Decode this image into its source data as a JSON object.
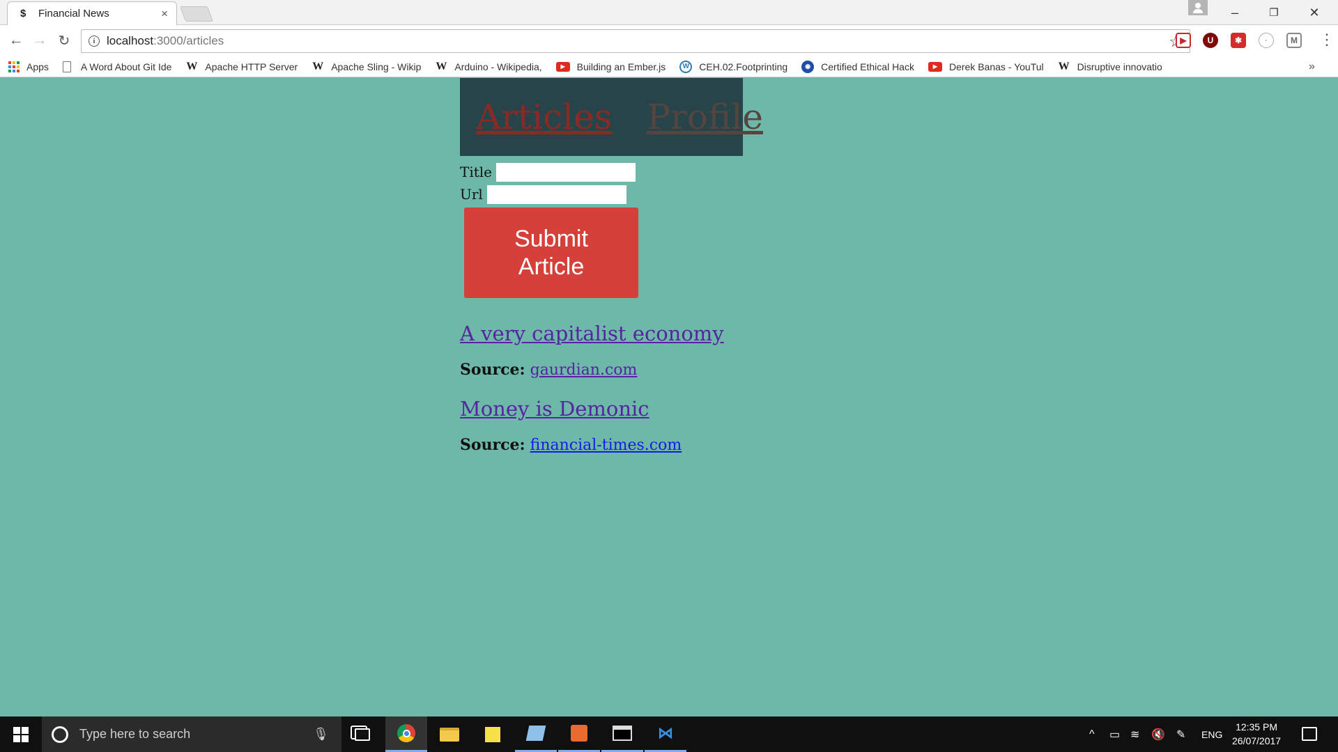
{
  "browser": {
    "tab": {
      "title": "Financial News",
      "favicon": "$",
      "close": "×"
    },
    "window_controls": {
      "minimize": "–",
      "restore": "❐",
      "close": "✕"
    },
    "address": {
      "host": "localhost",
      "path": ":3000/articles"
    },
    "bookmarks": [
      {
        "label": "Apps",
        "icon": "apps-icon"
      },
      {
        "label": "A Word About Git Ide",
        "icon": "document-icon"
      },
      {
        "label": "Apache HTTP Server",
        "icon": "wikipedia-icon"
      },
      {
        "label": "Apache Sling - Wikip",
        "icon": "wikipedia-icon"
      },
      {
        "label": "Arduino - Wikipedia,",
        "icon": "wikipedia-icon"
      },
      {
        "label": "Building an Ember.js",
        "icon": "youtube-icon"
      },
      {
        "label": "CEH.02.Footprinting",
        "icon": "wordpress-icon"
      },
      {
        "label": "Certified Ethical Hack",
        "icon": "globe-icon"
      },
      {
        "label": "Derek Banas - YouTul",
        "icon": "youtube-icon"
      },
      {
        "label": "Disruptive innovatio",
        "icon": "wikipedia-icon"
      }
    ],
    "more_bookmarks": "»"
  },
  "app": {
    "nav": {
      "articles": "Articles",
      "profile": "Profile"
    },
    "form": {
      "title_label": "Title",
      "title_value": "",
      "url_label": "Url",
      "url_value": "",
      "submit_line1": "Submit",
      "submit_line2": "Article"
    },
    "articles": [
      {
        "title": "A very capitalist economy",
        "source_label": "Source:",
        "source": "gaurdian.com"
      },
      {
        "title": "Money is Demonic",
        "source_label": "Source:",
        "source": "financial-times.com"
      }
    ]
  },
  "taskbar": {
    "search_placeholder": "Type here to search",
    "language": "ENG",
    "time": "12:35 PM",
    "date": "26/07/2017"
  },
  "colors": {
    "page_bg": "#6db8a9",
    "nav_bg": "#264449",
    "submit_bg": "#d5413a",
    "visited_link": "#5624a0",
    "link": "#1a1ae6"
  }
}
